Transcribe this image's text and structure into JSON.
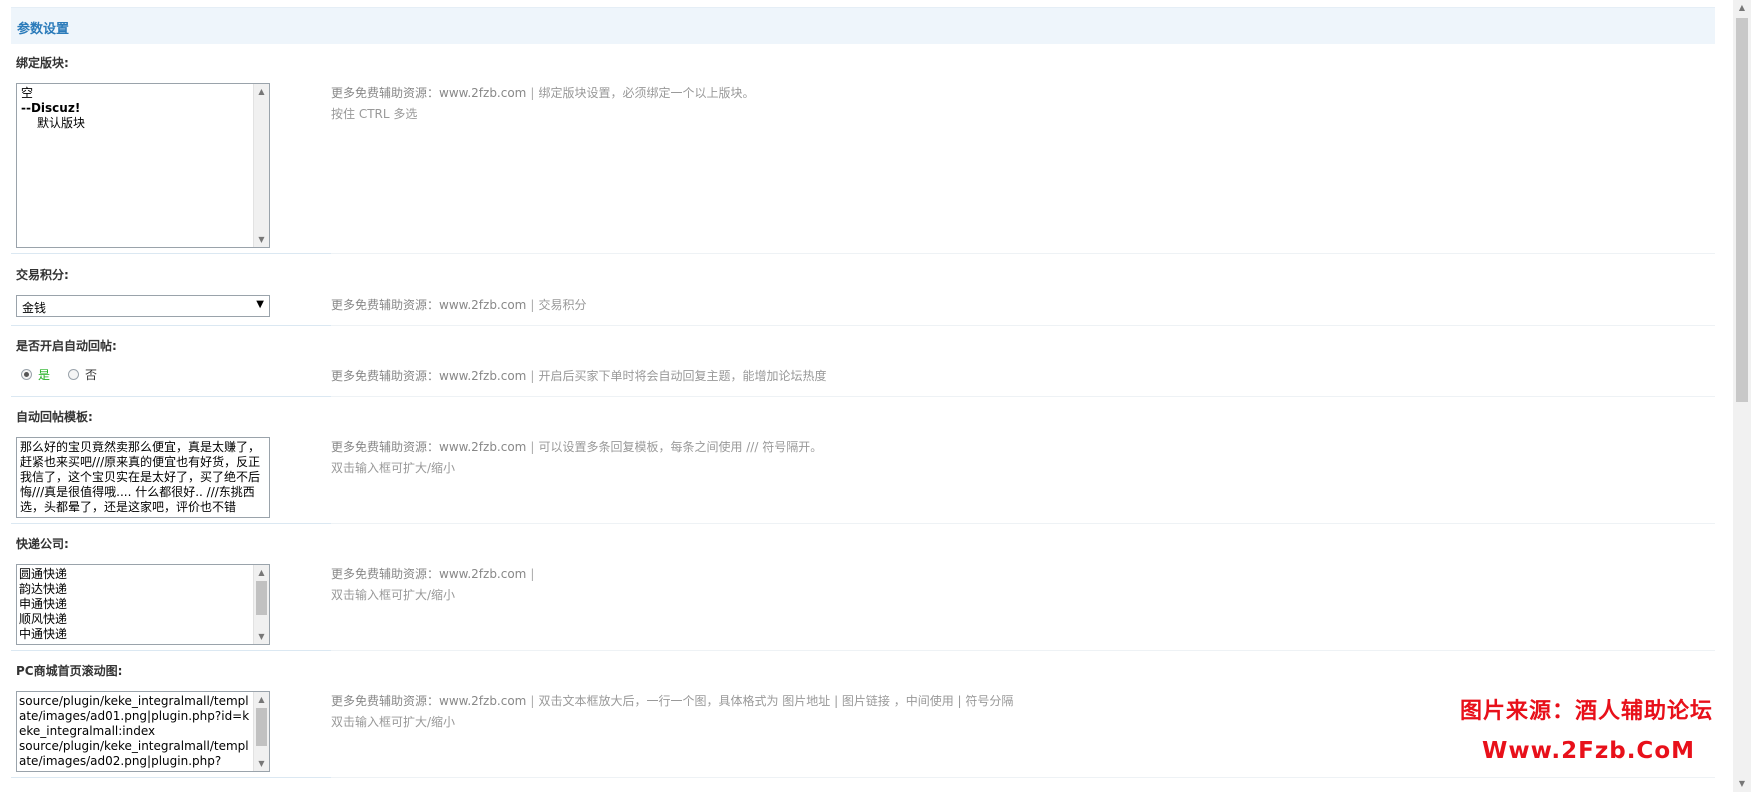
{
  "section_title": "参数设置",
  "tip_site": "更多免费辅助资源：www.2fzb.com",
  "tip_sep": "|",
  "fields": {
    "bind_block": {
      "label": "绑定版块:",
      "options": [
        "空",
        "--Discuz!",
        "默认版块"
      ],
      "tip": "绑定版块设置，必须绑定一个以上版块。",
      "tip2": "按住 CTRL 多选"
    },
    "trade_credit": {
      "label": "交易积分:",
      "selected": "金钱",
      "tip": "交易积分"
    },
    "auto_reply": {
      "label": "是否开启自动回帖:",
      "yes": "是",
      "no": "否",
      "tip": "开启后买家下单时将会自动回复主题，能增加论坛热度"
    },
    "reply_template": {
      "label": "自动回帖模板:",
      "value": "那么好的宝贝竟然卖那么便宜，真是太赚了，赶紧也来买吧///原来真的便宜也有好货，反正我信了，这个宝贝实在是太好了，买了绝不后悔///真是很值得哦.... 什么都很好.. ///东挑西选，头都晕了，还是这家吧，评价也不错",
      "tip": "可以设置多条回复模板，每条之间使用 /// 符号隔开。",
      "tip2": "双击输入框可扩大/缩小"
    },
    "express": {
      "label": "快递公司:",
      "options": [
        "圆通快递",
        "韵达快递",
        "申通快递",
        "顺风快递",
        "中通快递"
      ],
      "tip": "",
      "tip2": "双击输入框可扩大/缩小"
    },
    "pc_slider": {
      "label": "PC商城首页滚动图:",
      "value": "source/plugin/keke_integralmall/template/images/ad01.png|plugin.php?id=keke_integralmall:index\nsource/plugin/keke_integralmall/template/images/ad02.png|plugin.php?",
      "tip": "双击文本框放大后，一行一个图，具体格式为 图片地址 | 图片链接 ，中间使用 | 符号分隔",
      "tip2": "双击输入框可扩大/缩小"
    }
  },
  "watermark": {
    "line1": "图片来源：酒人辅助论坛",
    "line2": "Www.2Fzb.CoM"
  }
}
